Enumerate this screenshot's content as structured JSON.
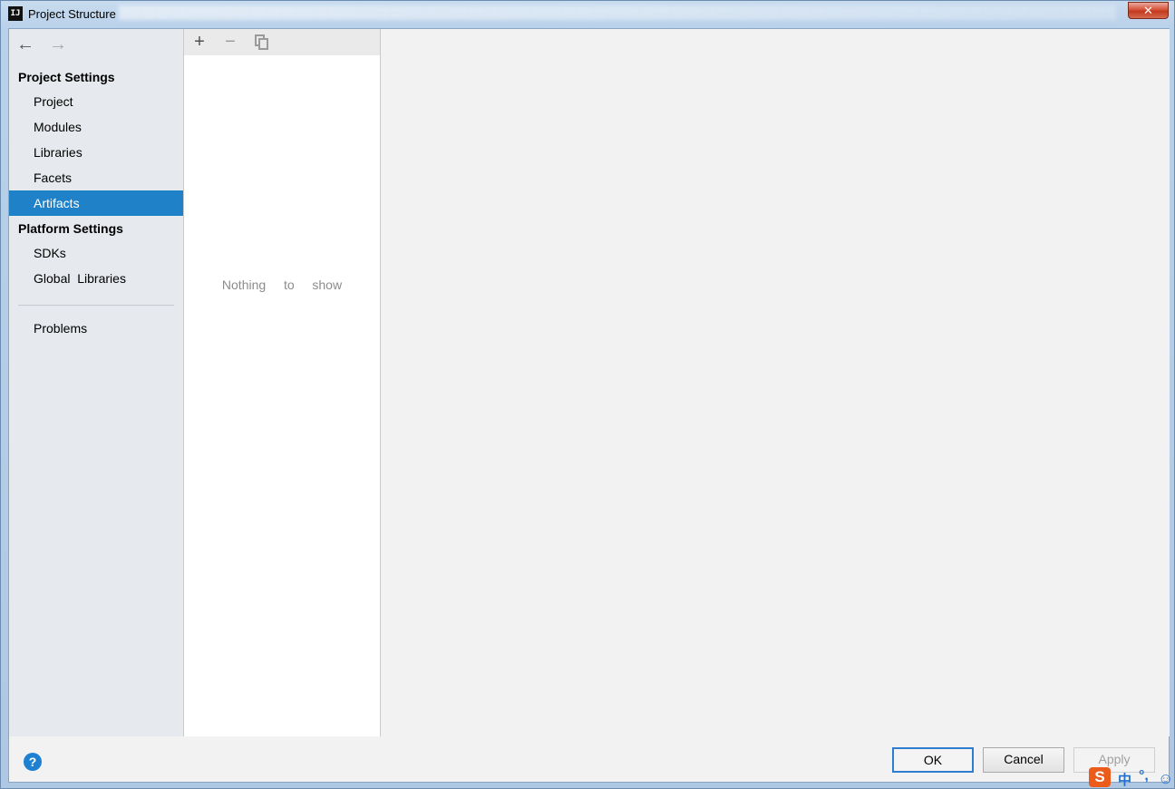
{
  "window": {
    "title": "Project Structure",
    "app_icon_text": "IJ",
    "close_glyph": "✕"
  },
  "sidebar": {
    "back_glyph": "←",
    "forward_glyph": "→",
    "sections": [
      {
        "header": "Project Settings",
        "items": [
          "Project",
          "Modules",
          "Libraries",
          "Facets",
          "Artifacts"
        ]
      },
      {
        "header": "Platform Settings",
        "items": [
          "SDKs",
          "Global  Libraries"
        ]
      }
    ],
    "extra_items": [
      "Problems"
    ],
    "selected": "Artifacts"
  },
  "list": {
    "add_glyph": "+",
    "remove_glyph": "−",
    "empty_text": "Nothing  to  show"
  },
  "footer": {
    "help_glyph": "?",
    "ok_label": "OK",
    "cancel_label": "Cancel",
    "apply_label": "Apply",
    "apply_enabled": false
  },
  "ime": {
    "logo": "S",
    "mode": "中",
    "punct": "°,",
    "emoji": "☺"
  },
  "colors": {
    "selection": "#1f82c9",
    "sidebar_bg": "#e6e9ed",
    "ok_border": "#2d7ed1",
    "help": "#1f7fd0",
    "ime_logo": "#ea5b1c"
  },
  "icons": {
    "back": "arrow-left-icon",
    "forward": "arrow-right-icon",
    "add": "plus-icon",
    "remove": "minus-icon",
    "copy": "copy-icon",
    "help": "question-icon",
    "close": "close-icon"
  }
}
